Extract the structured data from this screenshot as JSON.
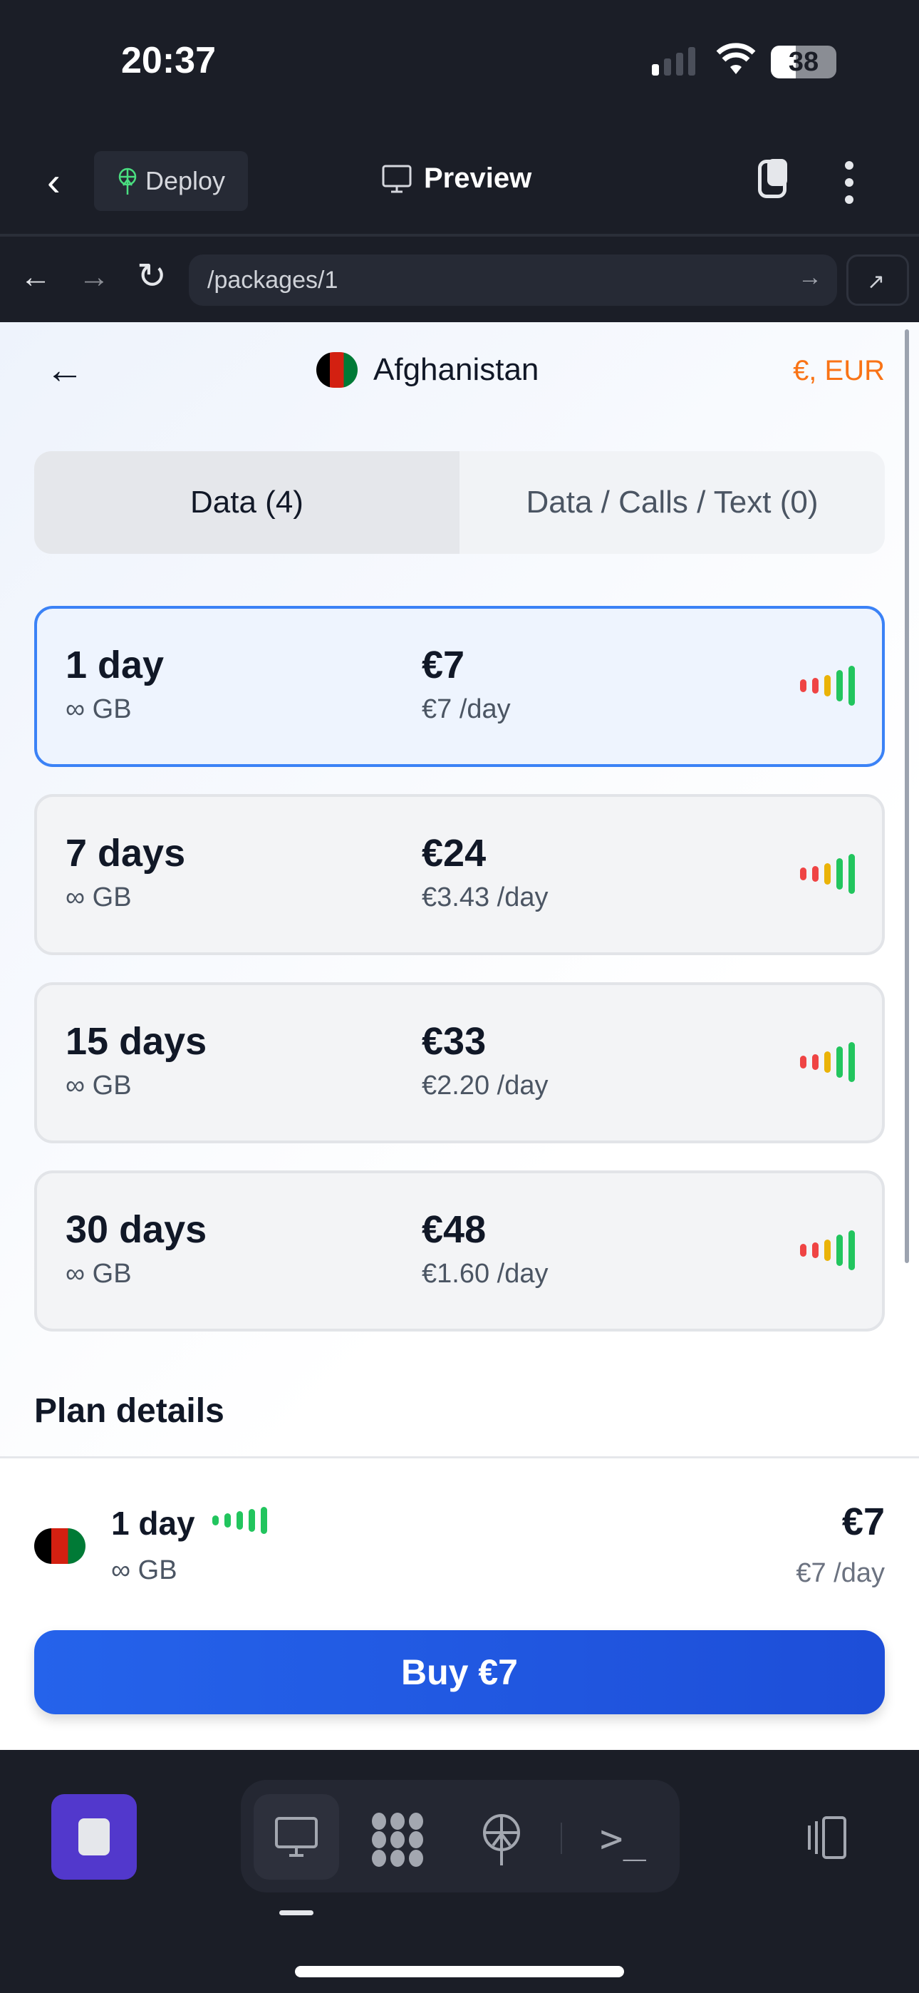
{
  "status": {
    "time": "20:37",
    "battery": "38"
  },
  "nav": {
    "deploy": "Deploy",
    "preview": "Preview"
  },
  "browser": {
    "url": "/packages/1"
  },
  "header": {
    "country": "Afghanistan",
    "currency": "€, EUR"
  },
  "tabs": [
    {
      "label": "Data (4)"
    },
    {
      "label": "Data / Calls / Text (0)"
    }
  ],
  "plans": [
    {
      "duration": "1 day",
      "data": "∞ GB",
      "price": "€7",
      "per_day": "€7 /day"
    },
    {
      "duration": "7 days",
      "data": "∞ GB",
      "price": "€24",
      "per_day": "€3.43 /day"
    },
    {
      "duration": "15 days",
      "data": "∞ GB",
      "price": "€33",
      "per_day": "€2.20 /day"
    },
    {
      "duration": "30 days",
      "data": "∞ GB",
      "price": "€48",
      "per_day": "€1.60 /day"
    }
  ],
  "plan_details_title": "Plan details",
  "summary": {
    "duration": "1 day",
    "data": "∞ GB",
    "price": "€7",
    "per_day": "€7 /day"
  },
  "buy_label": "Buy €7",
  "colors": {
    "accent": "#2563eb",
    "currency": "#f97316",
    "selected_border": "#3b82f6"
  }
}
